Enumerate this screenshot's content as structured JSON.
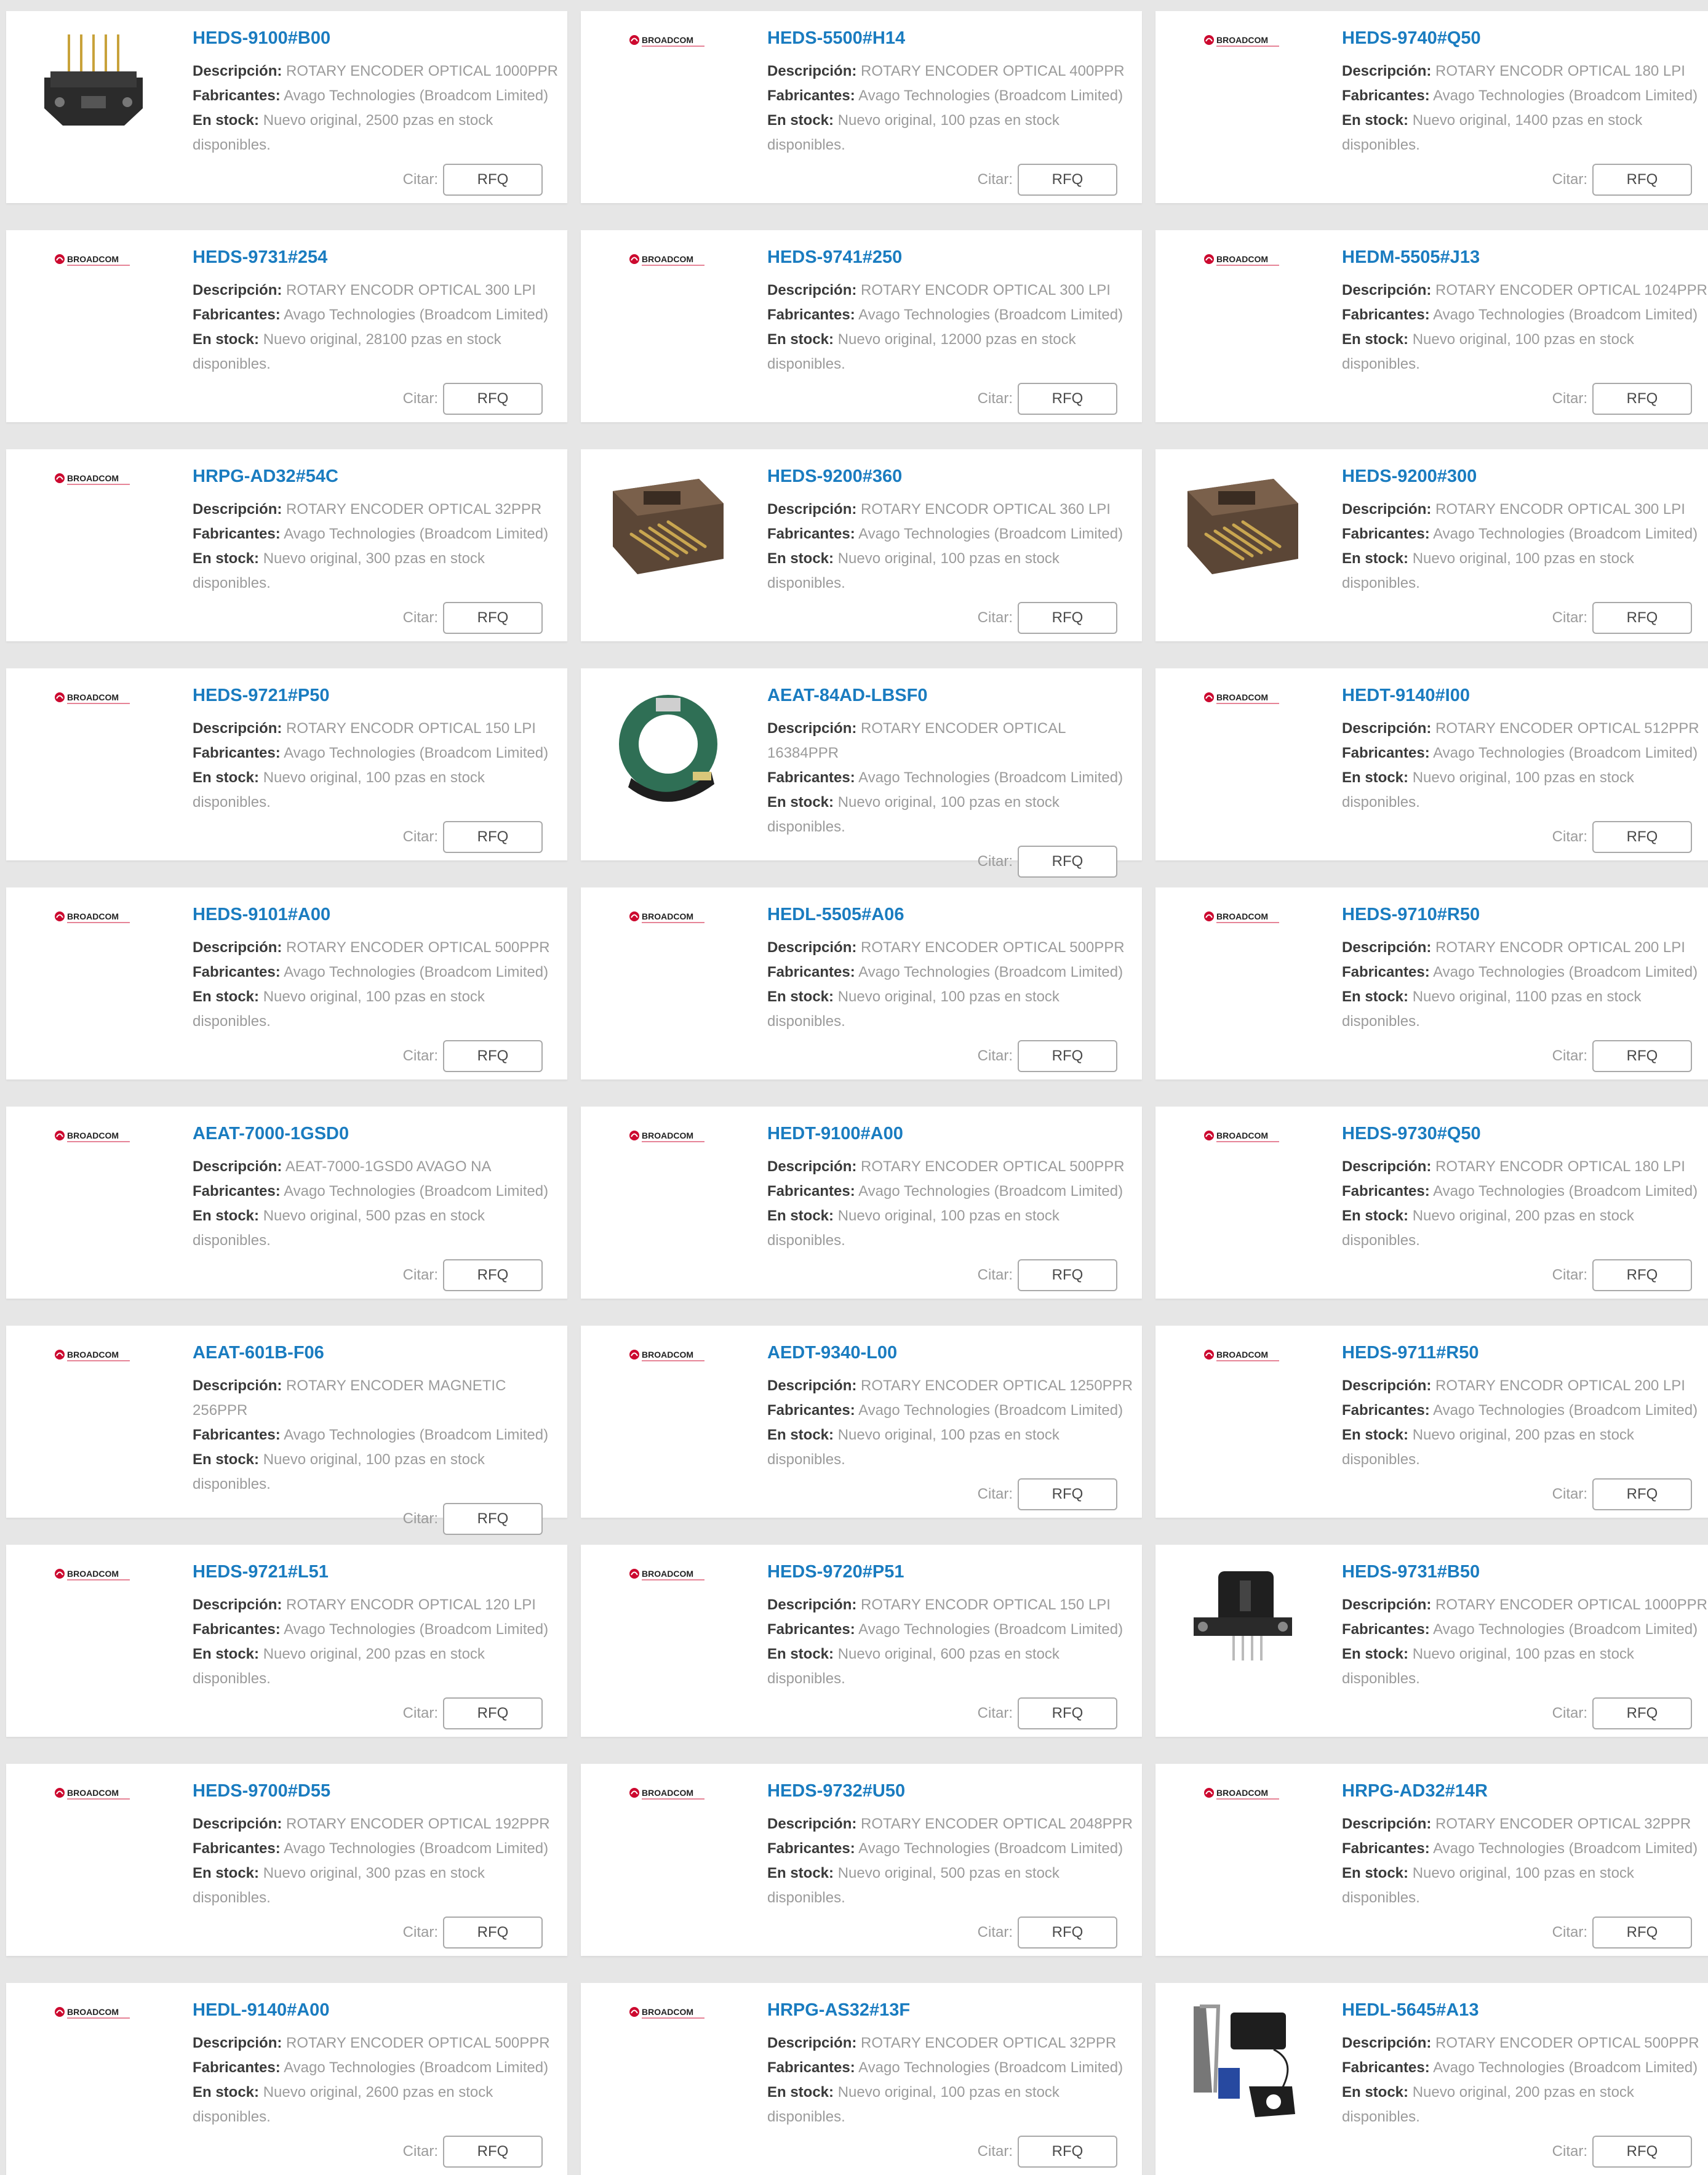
{
  "labels": {
    "description": "Descripción:",
    "manufacturer": "Fabricantes:",
    "stock": "En stock:",
    "quote": "Citar:",
    "rfq": "RFQ",
    "logo_text": "BROADCOM"
  },
  "products": [
    {
      "part": "HEDS-9100#B00",
      "description": "ROTARY ENCODER OPTICAL 1000PPR",
      "manufacturer": "Avago Technologies (Broadcom Limited)",
      "stock": "Nuevo original, 2500 pzas en stock",
      "stock2": "disponibles.",
      "image": "encoder-module-gold-pins"
    },
    {
      "part": "HEDS-5500#H14",
      "description": "ROTARY ENCODER OPTICAL 400PPR",
      "manufacturer": "Avago Technologies (Broadcom Limited)",
      "stock": "Nuevo original, 100 pzas en stock",
      "stock2": "disponibles.",
      "image": "broadcom-logo"
    },
    {
      "part": "HEDS-9740#Q50",
      "description": "ROTARY ENCODR OPTICAL 180 LPI",
      "manufacturer": "Avago Technologies (Broadcom Limited)",
      "stock": "Nuevo original, 1400 pzas en stock",
      "stock2": "disponibles.",
      "image": "broadcom-logo"
    },
    {
      "part": "HEDS-9731#254",
      "description": "ROTARY ENCODR OPTICAL 300 LPI",
      "manufacturer": "Avago Technologies (Broadcom Limited)",
      "stock": "Nuevo original, 28100 pzas en stock",
      "stock2": "disponibles.",
      "image": "broadcom-logo"
    },
    {
      "part": "HEDS-9741#250",
      "description": "ROTARY ENCODR OPTICAL 300 LPI",
      "manufacturer": "Avago Technologies (Broadcom Limited)",
      "stock": "Nuevo original, 12000 pzas en stock",
      "stock2": "disponibles.",
      "image": "broadcom-logo"
    },
    {
      "part": "HEDM-5505#J13",
      "description": "ROTARY ENCODER OPTICAL 1024PPR",
      "manufacturer": "Avago Technologies (Broadcom Limited)",
      "stock": "Nuevo original, 100 pzas en stock",
      "stock2": "disponibles.",
      "image": "broadcom-logo"
    },
    {
      "part": "HRPG-AD32#54C",
      "description": "ROTARY ENCODER OPTICAL 32PPR",
      "manufacturer": "Avago Technologies (Broadcom Limited)",
      "stock": "Nuevo original, 300 pzas en stock",
      "stock2": "disponibles.",
      "image": "broadcom-logo"
    },
    {
      "part": "HEDS-9200#360",
      "description": "ROTARY ENCODR OPTICAL 360 LPI",
      "manufacturer": "Avago Technologies (Broadcom Limited)",
      "stock": "Nuevo original, 100 pzas en stock",
      "stock2": "disponibles.",
      "image": "encoder-module-brown"
    },
    {
      "part": "HEDS-9200#300",
      "description": "ROTARY ENCODR OPTICAL 300 LPI",
      "manufacturer": "Avago Technologies (Broadcom Limited)",
      "stock": "Nuevo original, 100 pzas en stock",
      "stock2": "disponibles.",
      "image": "encoder-module-brown"
    },
    {
      "part": "HEDS-9721#P50",
      "description": "ROTARY ENCODR OPTICAL 150 LPI",
      "manufacturer": "Avago Technologies (Broadcom Limited)",
      "stock": "Nuevo original, 100 pzas en stock",
      "stock2": "disponibles.",
      "image": "broadcom-logo"
    },
    {
      "part": "AEAT-84AD-LBSF0",
      "description": "ROTARY ENCODER OPTICAL",
      "description2": "16384PPR",
      "manufacturer": "Avago Technologies (Broadcom Limited)",
      "stock": "Nuevo original, 100 pzas en stock",
      "stock2": "disponibles.",
      "image": "encoder-ring-green"
    },
    {
      "part": "HEDT-9140#I00",
      "description": "ROTARY ENCODER OPTICAL 512PPR",
      "manufacturer": "Avago Technologies (Broadcom Limited)",
      "stock": "Nuevo original, 100 pzas en stock",
      "stock2": "disponibles.",
      "image": "broadcom-logo"
    },
    {
      "part": "HEDS-9101#A00",
      "description": "ROTARY ENCODER OPTICAL 500PPR",
      "manufacturer": "Avago Technologies (Broadcom Limited)",
      "stock": "Nuevo original, 100 pzas en stock",
      "stock2": "disponibles.",
      "image": "broadcom-logo"
    },
    {
      "part": "HEDL-5505#A06",
      "description": "ROTARY ENCODER OPTICAL 500PPR",
      "manufacturer": "Avago Technologies (Broadcom Limited)",
      "stock": "Nuevo original, 100 pzas en stock",
      "stock2": "disponibles.",
      "image": "broadcom-logo"
    },
    {
      "part": "HEDS-9710#R50",
      "description": "ROTARY ENCODR OPTICAL 200 LPI",
      "manufacturer": "Avago Technologies (Broadcom Limited)",
      "stock": "Nuevo original, 1100 pzas en stock",
      "stock2": "disponibles.",
      "image": "broadcom-logo"
    },
    {
      "part": "AEAT-7000-1GSD0",
      "description": "AEAT-7000-1GSD0 AVAGO NA",
      "manufacturer": "Avago Technologies (Broadcom Limited)",
      "stock": "Nuevo original, 500 pzas en stock",
      "stock2": "disponibles.",
      "image": "broadcom-logo"
    },
    {
      "part": "HEDT-9100#A00",
      "description": "ROTARY ENCODER OPTICAL 500PPR",
      "manufacturer": "Avago Technologies (Broadcom Limited)",
      "stock": "Nuevo original, 100 pzas en stock",
      "stock2": "disponibles.",
      "image": "broadcom-logo"
    },
    {
      "part": "HEDS-9730#Q50",
      "description": "ROTARY ENCODR OPTICAL 180 LPI",
      "manufacturer": "Avago Technologies (Broadcom Limited)",
      "stock": "Nuevo original, 200 pzas en stock",
      "stock2": "disponibles.",
      "image": "broadcom-logo"
    },
    {
      "part": "AEAT-601B-F06",
      "description": "ROTARY ENCODER MAGNETIC",
      "description2": "256PPR",
      "manufacturer": "Avago Technologies (Broadcom Limited)",
      "stock": "Nuevo original, 100 pzas en stock",
      "stock2": "disponibles.",
      "image": "broadcom-logo"
    },
    {
      "part": "AEDT-9340-L00",
      "description": "ROTARY ENCODER OPTICAL 1250PPR",
      "manufacturer": "Avago Technologies (Broadcom Limited)",
      "stock": "Nuevo original, 100 pzas en stock",
      "stock2": "disponibles.",
      "image": "broadcom-logo"
    },
    {
      "part": "HEDS-9711#R50",
      "description": "ROTARY ENCODR OPTICAL 200 LPI",
      "manufacturer": "Avago Technologies (Broadcom Limited)",
      "stock": "Nuevo original, 200 pzas en stock",
      "stock2": "disponibles.",
      "image": "broadcom-logo"
    },
    {
      "part": "HEDS-9721#L51",
      "description": "ROTARY ENCODR OPTICAL 120 LPI",
      "manufacturer": "Avago Technologies (Broadcom Limited)",
      "stock": "Nuevo original, 200 pzas en stock",
      "stock2": "disponibles.",
      "image": "broadcom-logo"
    },
    {
      "part": "HEDS-9720#P51",
      "description": "ROTARY ENCODR OPTICAL 150 LPI",
      "manufacturer": "Avago Technologies (Broadcom Limited)",
      "stock": "Nuevo original, 600 pzas en stock",
      "stock2": "disponibles.",
      "image": "broadcom-logo"
    },
    {
      "part": "HEDS-9731#B50",
      "description": "ROTARY ENCODER OPTICAL 1000PPR",
      "manufacturer": "Avago Technologies (Broadcom Limited)",
      "stock": "Nuevo original, 100 pzas en stock",
      "stock2": "disponibles.",
      "image": "encoder-module-black"
    },
    {
      "part": "HEDS-9700#D55",
      "description": "ROTARY ENCODER OPTICAL 192PPR",
      "manufacturer": "Avago Technologies (Broadcom Limited)",
      "stock": "Nuevo original, 300 pzas en stock",
      "stock2": "disponibles.",
      "image": "broadcom-logo"
    },
    {
      "part": "HEDS-9732#U50",
      "description": "ROTARY ENCODER OPTICAL 2048PPR",
      "manufacturer": "Avago Technologies (Broadcom Limited)",
      "stock": "Nuevo original, 500 pzas en stock",
      "stock2": "disponibles.",
      "image": "broadcom-logo"
    },
    {
      "part": "HRPG-AD32#14R",
      "description": "ROTARY ENCODER OPTICAL 32PPR",
      "manufacturer": "Avago Technologies (Broadcom Limited)",
      "stock": "Nuevo original, 100 pzas en stock",
      "stock2": "disponibles.",
      "image": "broadcom-logo"
    },
    {
      "part": "HEDL-9140#A00",
      "description": "ROTARY ENCODER OPTICAL 500PPR",
      "manufacturer": "Avago Technologies (Broadcom Limited)",
      "stock": "Nuevo original, 2600 pzas en stock",
      "stock2": "disponibles.",
      "image": "broadcom-logo"
    },
    {
      "part": "HRPG-AS32#13F",
      "description": "ROTARY ENCODER OPTICAL 32PPR",
      "manufacturer": "Avago Technologies (Broadcom Limited)",
      "stock": "Nuevo original, 100 pzas en stock",
      "stock2": "disponibles.",
      "image": "broadcom-logo"
    },
    {
      "part": "HEDL-5645#A13",
      "description": "ROTARY ENCODER OPTICAL 500PPR",
      "manufacturer": "Avago Technologies (Broadcom Limited)",
      "stock": "Nuevo original, 200 pzas en stock",
      "stock2": "disponibles.",
      "image": "encoder-kit-cable"
    }
  ],
  "colors": {
    "part_link": "#1a7cc0",
    "background": "#e6e6e6",
    "broadcom_red": "#cc092f"
  }
}
